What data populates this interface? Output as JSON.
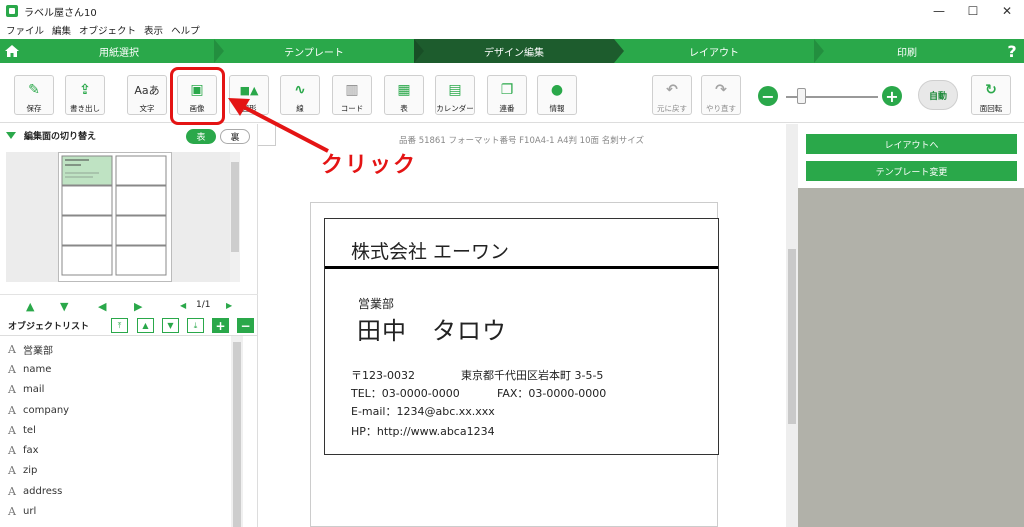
{
  "app": {
    "title": "ラベル屋さん10"
  },
  "window_controls": {
    "minimize": "—",
    "maximize": "☐",
    "close": "✕"
  },
  "menu": [
    "ファイル",
    "編集",
    "オブジェクト",
    "表示",
    "ヘルプ"
  ],
  "steps": [
    {
      "label": "用紙選択",
      "active": false
    },
    {
      "label": "テンプレート",
      "active": false
    },
    {
      "label": "デザイン編集",
      "active": true
    },
    {
      "label": "レイアウト",
      "active": false
    },
    {
      "label": "印刷",
      "active": false
    }
  ],
  "help_label": "?",
  "toolbar": {
    "buttons": [
      {
        "label": "保存",
        "icon": "save-icon",
        "glyph": "✎"
      },
      {
        "label": "書き出し",
        "icon": "export-icon",
        "glyph": "⇪"
      },
      {
        "label": "文字",
        "icon": "text-icon",
        "glyph": "Aaあ"
      },
      {
        "label": "画像",
        "icon": "image-icon",
        "glyph": "▣"
      },
      {
        "label": "図形",
        "icon": "shape-icon",
        "glyph": "■▲"
      },
      {
        "label": "線",
        "icon": "line-icon",
        "glyph": "∿"
      },
      {
        "label": "コード",
        "icon": "barcode-icon",
        "glyph": "▥"
      },
      {
        "label": "表",
        "icon": "table-icon",
        "glyph": "▦"
      },
      {
        "label": "カレンダー",
        "icon": "calendar-icon",
        "glyph": "▤"
      },
      {
        "label": "連番",
        "icon": "serial-number-icon",
        "glyph": "❐"
      },
      {
        "label": "情報",
        "icon": "info-person-icon",
        "glyph": "●"
      }
    ],
    "undo_label": "元に戻す",
    "redo_label": "やり直す",
    "zoom_minus": "−",
    "zoom_plus": "+",
    "zoom_level": 0.15,
    "auto_label": "自動",
    "rotate_label": "面回転"
  },
  "annotation": {
    "text": "クリック",
    "color": "#e41414"
  },
  "left_panel": {
    "title": "編集面の切り替え",
    "front_label": "表",
    "back_label": "裏",
    "page_indicator": "1/1",
    "object_list_title": "オブジェクトリスト",
    "objects": [
      "営業部",
      "name",
      "mail",
      "company",
      "tel",
      "fax",
      "zip",
      "address",
      "url"
    ]
  },
  "canvas": {
    "info": "品番 51861 フォーマット番号 F10A4-1 A4判 10面 名刺サイズ",
    "card": {
      "company": "株式会社 エーワン",
      "department": "営業部",
      "name": "田中　タロウ",
      "zip": "〒123-0032",
      "address": "東京都千代田区岩本町 3-5-5",
      "tel": "TEL：03-0000-0000",
      "fax": "FAX：03-0000-0000",
      "email": "E-mail：1234@abc.xx.xxx",
      "hp": "HP：http://www.abca1234"
    }
  },
  "right_panel": {
    "layout_button": "レイアウトへ",
    "template_button": "テンプレート変更"
  },
  "colors": {
    "brand_green": "#2aa84a",
    "active_step": "#1d5c2d"
  }
}
